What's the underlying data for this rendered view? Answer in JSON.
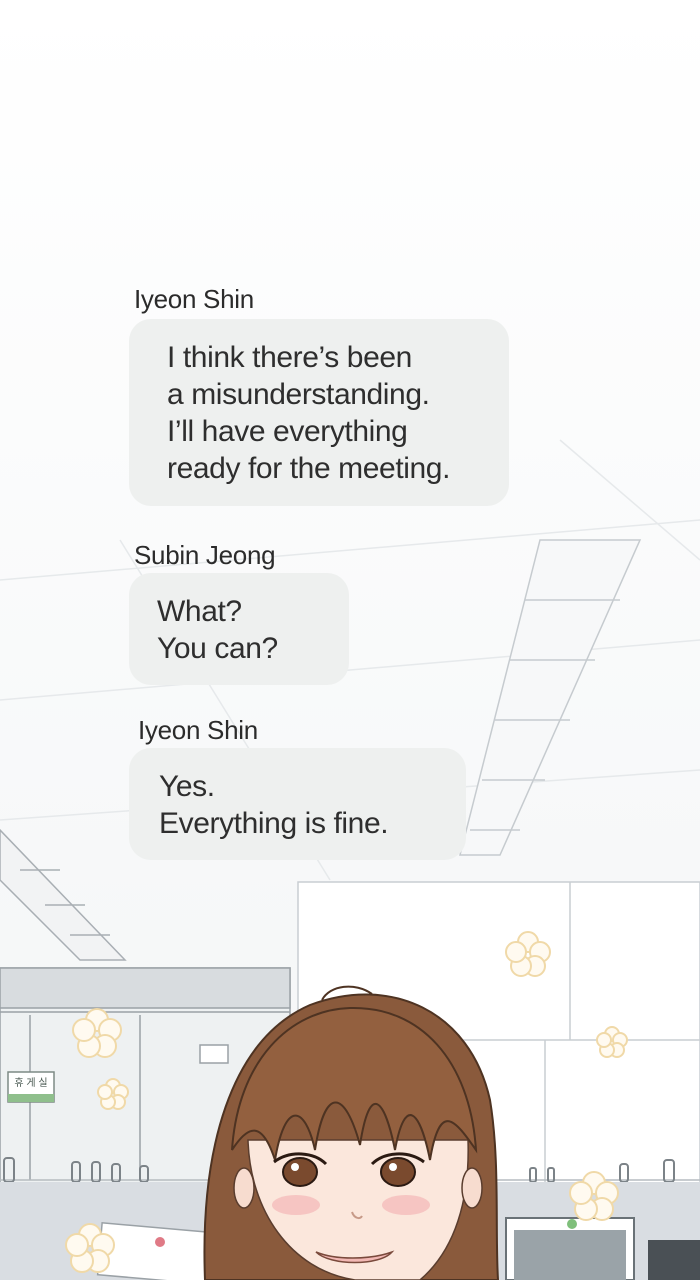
{
  "chat": {
    "messages": [
      {
        "sender": "Iyeon Shin",
        "lines": [
          "I think there’s been",
          "a misunderstanding.",
          "I’ll have everything",
          "ready for the meeting."
        ]
      },
      {
        "sender": "Subin Jeong",
        "lines": [
          "What?",
          "You can?"
        ]
      },
      {
        "sender": "Iyeon Shin",
        "lines": [
          "Yes.",
          "Everything is fine."
        ]
      }
    ]
  },
  "background": {
    "sign_text": "휴 게 실",
    "colors": {
      "hair": "#8a5a3c",
      "skin": "#fbe7dc",
      "bubble": "#eef0ef",
      "line": "#c9ced2"
    }
  }
}
